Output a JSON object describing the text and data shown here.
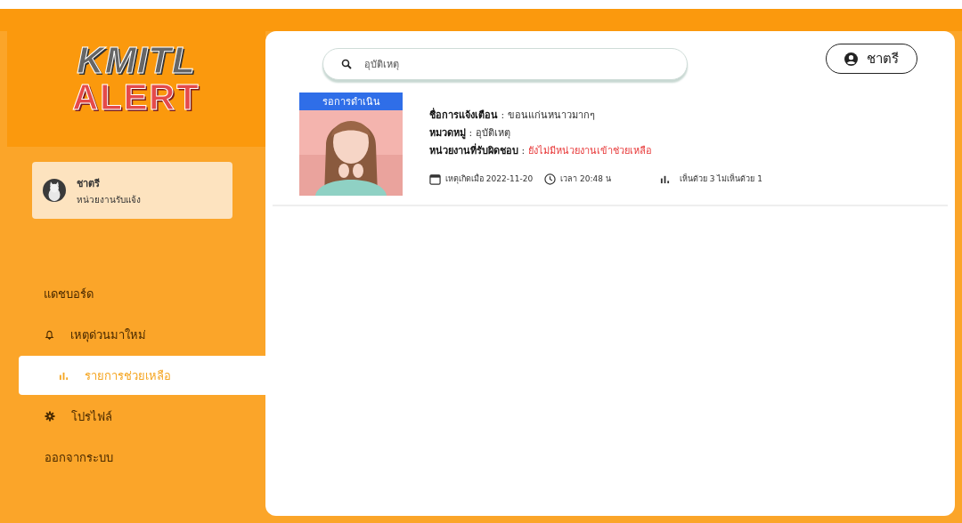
{
  "logo": {
    "lines": [
      "KMITL",
      "ALERT"
    ]
  },
  "user_card": {
    "name": "ชาตรี",
    "role": "หน่วยงานรับแจ้ง"
  },
  "menu": [
    {
      "label": "แดชบอร์ด",
      "selected": false
    },
    {
      "label": "เหตุด่วนมาใหม่",
      "selected": false
    },
    {
      "label": "รายการช่วยเหลือ",
      "selected": true
    },
    {
      "label": "โปรไฟล์",
      "selected": false
    },
    {
      "label": "ออกจากระบบ",
      "selected": false
    }
  ],
  "search": {
    "value": "อุบัติเหตุ"
  },
  "account_button": {
    "label": "ชาตรี"
  },
  "reports": [
    {
      "status": "รอการดำเนิน",
      "fields": [
        {
          "label": "ชื่อการแจ้งเตือน",
          "separator": ":",
          "value": "ขอนแก่นหนาวมากๆ",
          "alert": false
        },
        {
          "label": "หมวดหมู่",
          "separator": ":",
          "value": "อุบัติเหตุ",
          "alert": false
        },
        {
          "label": "หน่วยงานที่รับผิดชอบ",
          "separator": ":",
          "value": "ยังไม่มีหน่วยงานเข้าช่วยเหลือ",
          "alert": true
        }
      ],
      "date": "เหตุเกิดเมื่อ 2022-11-20",
      "time": "เวลา 20:48 น",
      "votes": "เห็นด้วย 3 ไม่เห็นด้วย 1"
    }
  ]
}
